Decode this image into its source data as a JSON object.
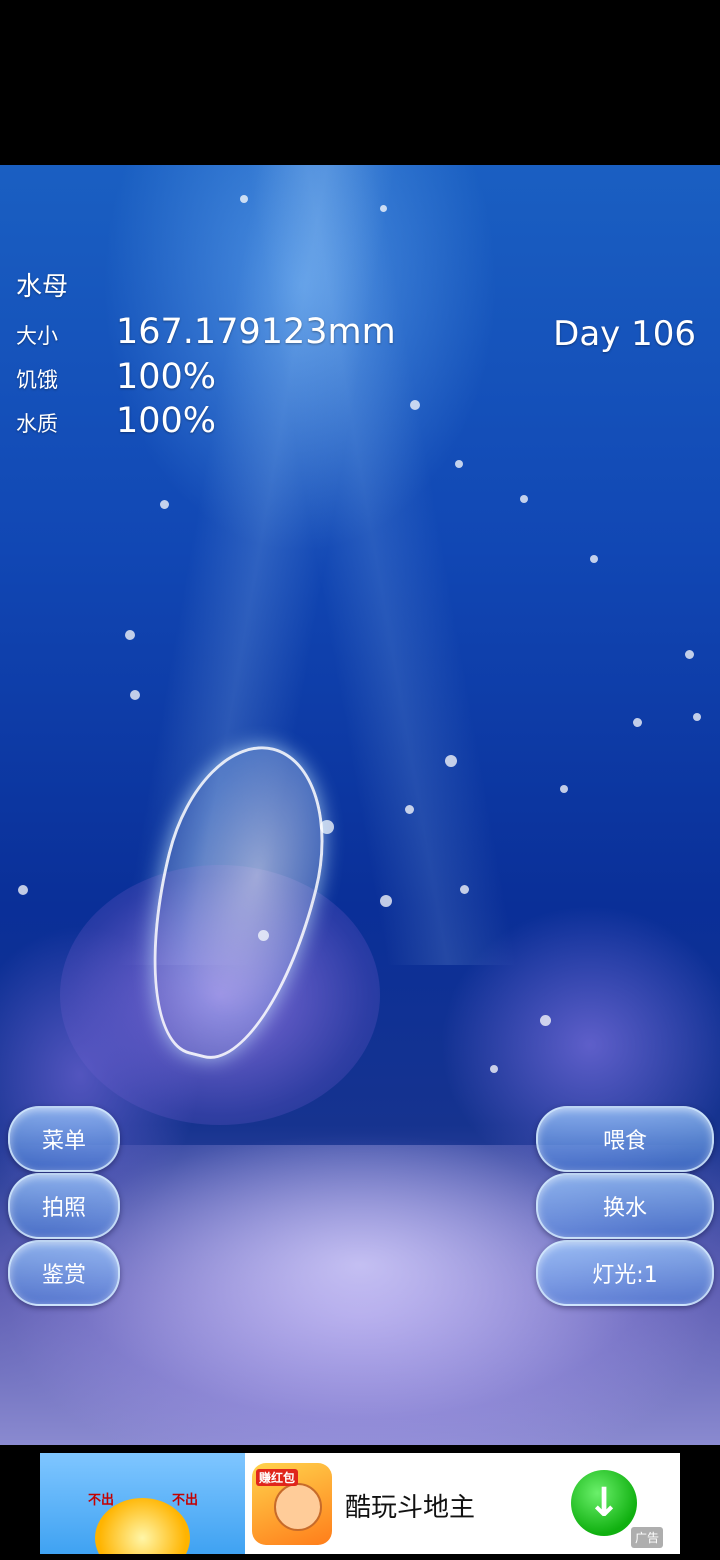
{
  "hud": {
    "name": "水母",
    "size_label": "大小",
    "size_value": "167.179123mm",
    "hunger_label": "饥饿",
    "hunger_value": "100%",
    "water_label": "水质",
    "water_value": "100%",
    "day": "Day 106"
  },
  "buttons_left": {
    "menu": "菜单",
    "photo": "拍照",
    "appreciate": "鉴赏"
  },
  "buttons_right": {
    "feed": "喂食",
    "change_water": "换水",
    "light": "灯光:1"
  },
  "ad": {
    "title": "酷玩斗地主",
    "icon_tag": "赚红包",
    "img_text_left": "不出",
    "img_text_right": "不出",
    "badge": "广告"
  },
  "colors": {
    "water_top": "#1a5fc2",
    "water_deep": "#0a2f98",
    "button_fill": "#7fb3f0",
    "download_green": "#10b010"
  }
}
